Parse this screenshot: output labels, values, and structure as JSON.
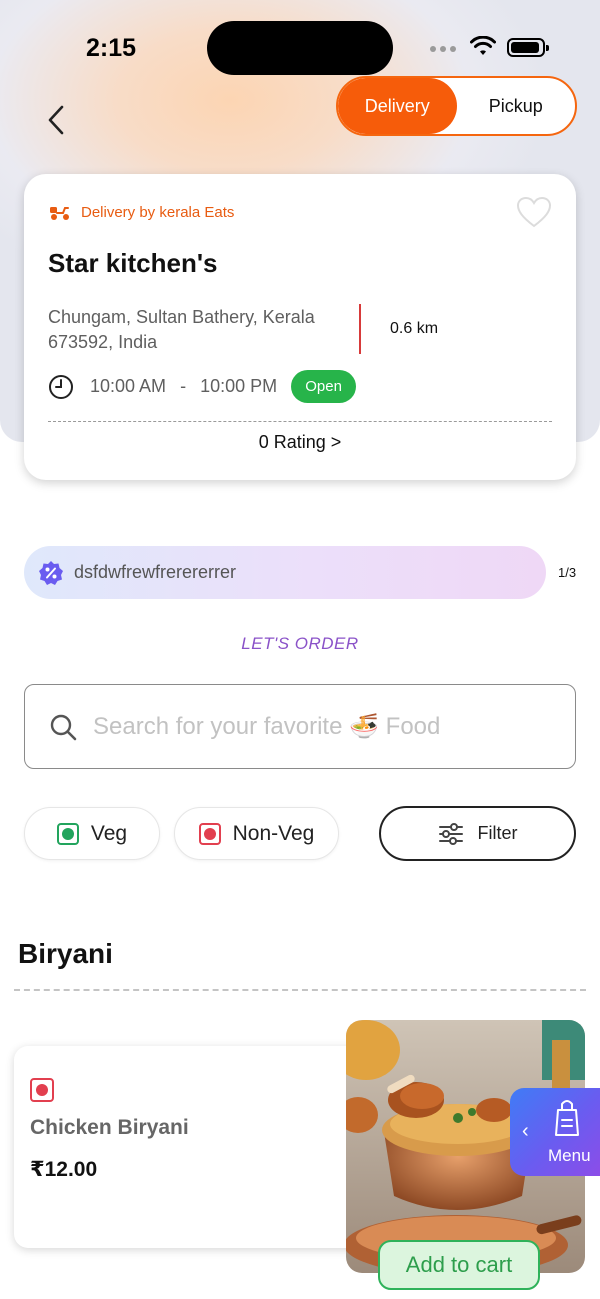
{
  "status_bar": {
    "time": "2:15"
  },
  "order_mode": {
    "delivery_label": "Delivery",
    "pickup_label": "Pickup",
    "selected": "Delivery"
  },
  "restaurant": {
    "delivery_by": "Delivery by kerala Eats",
    "name": "Star kitchen's",
    "address": "Chungam, Sultan Bathery, Kerala 673592, India",
    "distance": "0.6 km",
    "open_time": "10:00 AM",
    "separator": "-",
    "close_time": "10:00 PM",
    "status": "Open",
    "rating": "0 Rating >"
  },
  "offer": {
    "text": "dsfdwfrewfrerererrer",
    "counter": "1/3"
  },
  "lets_order": "LET'S ORDER",
  "search": {
    "placeholder": "Search for your favorite 🍜 Food"
  },
  "filters": {
    "veg_label": "Veg",
    "nonveg_label": "Non-Veg",
    "filter_label": "Filter"
  },
  "category": {
    "title": "Biryani",
    "items": [
      {
        "name": "Chicken Biryani",
        "price": "₹12.00",
        "type": "non-veg",
        "cta": "Add to cart"
      }
    ]
  },
  "menu_fab": {
    "label": "Menu"
  },
  "colors": {
    "accent": "#f65c0a",
    "open_green": "#27b44a",
    "veg_green": "#22a45d",
    "nonveg_red": "#e23f4f",
    "lets_order_purple": "#8a52c8"
  }
}
